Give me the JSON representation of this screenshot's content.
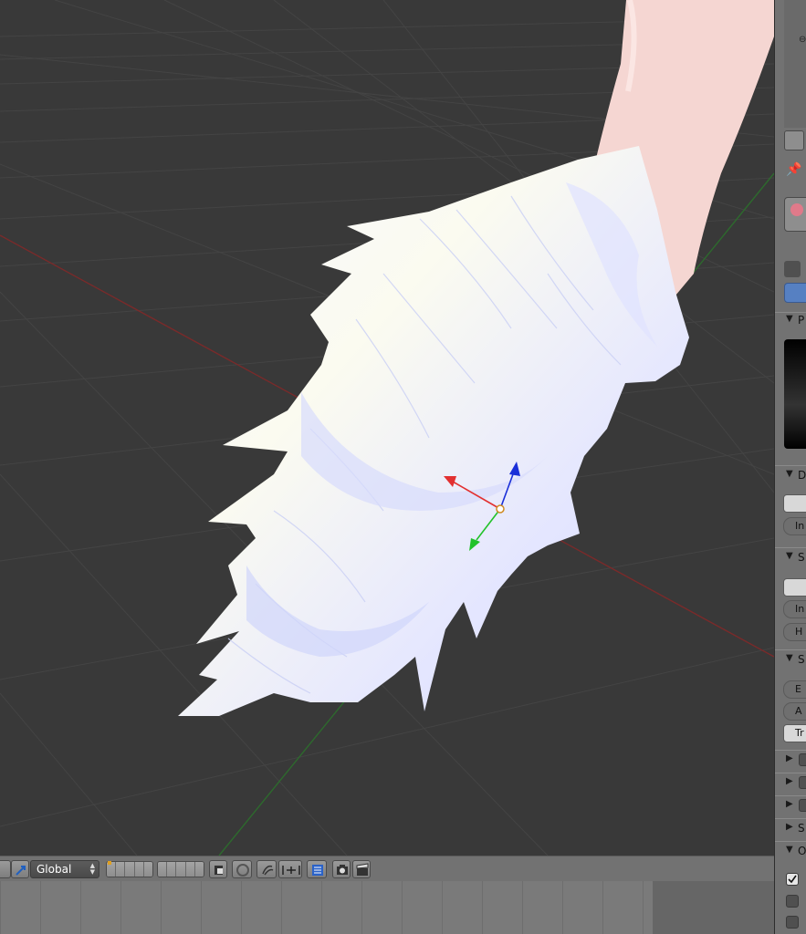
{
  "viewport": {
    "name": "3D Viewport",
    "object": "paw mesh with white fur",
    "colors": {
      "background": "#393939",
      "grid": "#444444",
      "x_axis": "#7a2a2a",
      "y_axis": "#2d6a2d",
      "fur": "#e8ebff",
      "skin": "#f4d4d1"
    },
    "manipulator": {
      "x_color": "#e23030",
      "y_color": "#22c22a",
      "z_color": "#1a2fd8"
    }
  },
  "header": {
    "orientation_value": "Global",
    "icons": [
      "manipulator-icon",
      "layers-grid-icon",
      "layers-grid-icon-2",
      "lock-camera-icon",
      "render-preview-icon",
      "snap-icon",
      "proportional-icon",
      "ruler-icon",
      "render-icon",
      "clapper-icon"
    ]
  },
  "properties": {
    "panel_labels": [
      "P",
      "D",
      "In",
      "S",
      "In",
      "H",
      "S",
      "E",
      "A",
      "Tr",
      "S",
      "O"
    ],
    "checkbox_states": [
      true,
      false,
      false
    ]
  }
}
